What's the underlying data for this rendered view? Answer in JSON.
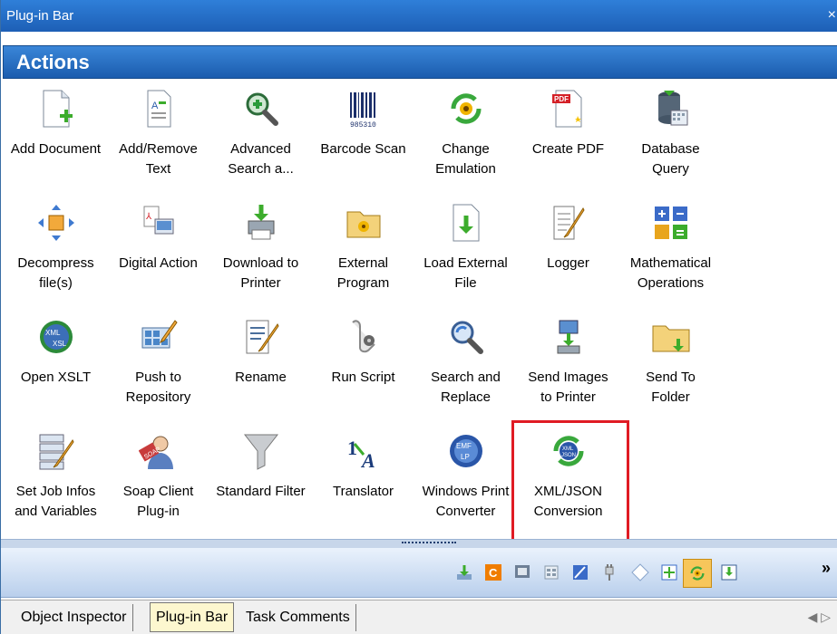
{
  "window": {
    "title": "Plug-in Bar",
    "close_glyph": "×"
  },
  "section": {
    "title": "Actions"
  },
  "items": [
    {
      "label": "Add Document",
      "icon": "add-document-icon"
    },
    {
      "label": "Add/Remove\nText",
      "icon": "text-edit-icon"
    },
    {
      "label": "Advanced\nSearch a...",
      "icon": "magnifier-icon"
    },
    {
      "label": "Barcode Scan",
      "icon": "barcode-icon"
    },
    {
      "label": "Change\nEmulation",
      "icon": "emulation-icon"
    },
    {
      "label": "Create PDF",
      "icon": "pdf-icon"
    },
    {
      "label": "Database\nQuery",
      "icon": "database-icon"
    },
    {
      "label": "Decompress\nfile(s)",
      "icon": "decompress-icon"
    },
    {
      "label": "Digital Action",
      "icon": "digital-action-icon"
    },
    {
      "label": "Download to\nPrinter",
      "icon": "printer-download-icon"
    },
    {
      "label": "External\nProgram",
      "icon": "external-program-icon"
    },
    {
      "label": "Load External\nFile",
      "icon": "load-file-icon"
    },
    {
      "label": "Logger",
      "icon": "logger-icon"
    },
    {
      "label": "Mathematical\nOperations",
      "icon": "math-icon"
    },
    {
      "label": "Open XSLT",
      "icon": "xslt-icon"
    },
    {
      "label": "Push to\nRepository",
      "icon": "repository-icon"
    },
    {
      "label": "Rename",
      "icon": "rename-icon"
    },
    {
      "label": "Run Script",
      "icon": "script-icon"
    },
    {
      "label": "Search and\nReplace",
      "icon": "search-replace-icon"
    },
    {
      "label": "Send Images\nto Printer",
      "icon": "send-images-icon"
    },
    {
      "label": "Send To\nFolder",
      "icon": "folder-icon"
    },
    {
      "label": "Set Job Infos\nand Variables",
      "icon": "job-infos-icon"
    },
    {
      "label": "Soap Client\nPlug-in",
      "icon": "soap-client-icon"
    },
    {
      "label": "Standard Filter",
      "icon": "filter-icon"
    },
    {
      "label": "Translator",
      "icon": "translator-icon"
    },
    {
      "label": "Windows Print\nConverter",
      "icon": "emf-icon"
    },
    {
      "label": "XML/JSON\nConversion",
      "icon": "xml-json-icon",
      "selected": true
    }
  ],
  "toolbar": {
    "buttons": [
      "download-icon",
      "c-icon",
      "screen-icon",
      "grid-icon",
      "chart-icon",
      "plug-icon",
      "diamond-icon",
      "fit-icon",
      "emulation-icon",
      "check-icon"
    ],
    "active_index": 8,
    "more_glyph": "»"
  },
  "tabs": [
    {
      "label": "Object Inspector",
      "active": false
    },
    {
      "label": "Plug-in Bar",
      "active": true
    },
    {
      "label": "Task Comments",
      "active": false
    }
  ],
  "tab_scroll": "◀ ▷"
}
